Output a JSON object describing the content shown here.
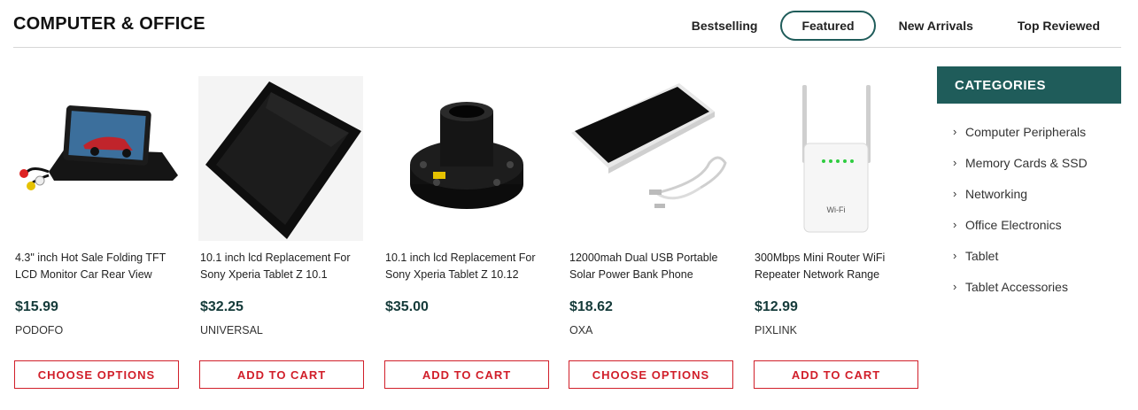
{
  "header": {
    "title": "COMPUTER & OFFICE",
    "tabs": [
      {
        "label": "Bestselling",
        "active": false
      },
      {
        "label": "Featured",
        "active": true
      },
      {
        "label": "New Arrivals",
        "active": false
      },
      {
        "label": "Top Reviewed",
        "active": false
      }
    ]
  },
  "products": [
    {
      "name": "4.3\" inch Hot Sale Folding TFT LCD Monitor Car Rear View",
      "price": "$15.99",
      "brand": "PODOFO",
      "button": "CHOOSE OPTIONS",
      "image_icon": "car-monitor-icon"
    },
    {
      "name": "10.1 inch lcd Replacement For Sony Xperia Tablet Z 10.1",
      "price": "$32.25",
      "brand": "UNIVERSAL",
      "button": "ADD TO CART",
      "image_icon": "lcd-panel-icon"
    },
    {
      "name": "10.1 inch lcd Replacement For Sony Xperia Tablet Z 10.12",
      "price": "$35.00",
      "brand": "",
      "button": "ADD TO CART",
      "image_icon": "steering-hub-icon"
    },
    {
      "name": "12000mah Dual USB Portable Solar Power Bank Phone",
      "price": "$18.62",
      "brand": "OXA",
      "button": "CHOOSE OPTIONS",
      "image_icon": "solar-power-bank-icon"
    },
    {
      "name": "300Mbps Mini Router WiFi Repeater Network Range",
      "price": "$12.99",
      "brand": "PIXLINK",
      "button": "ADD TO CART",
      "image_icon": "wifi-repeater-icon"
    }
  ],
  "sidebar": {
    "title": "CATEGORIES",
    "items": [
      {
        "label": "Computer Peripherals"
      },
      {
        "label": "Memory Cards & SSD"
      },
      {
        "label": "Networking"
      },
      {
        "label": "Office Electronics"
      },
      {
        "label": "Tablet"
      },
      {
        "label": "Tablet Accessories"
      }
    ]
  },
  "colors": {
    "accent": "#1f5c5a",
    "button_red": "#d11f2a",
    "price": "#153b3a"
  }
}
